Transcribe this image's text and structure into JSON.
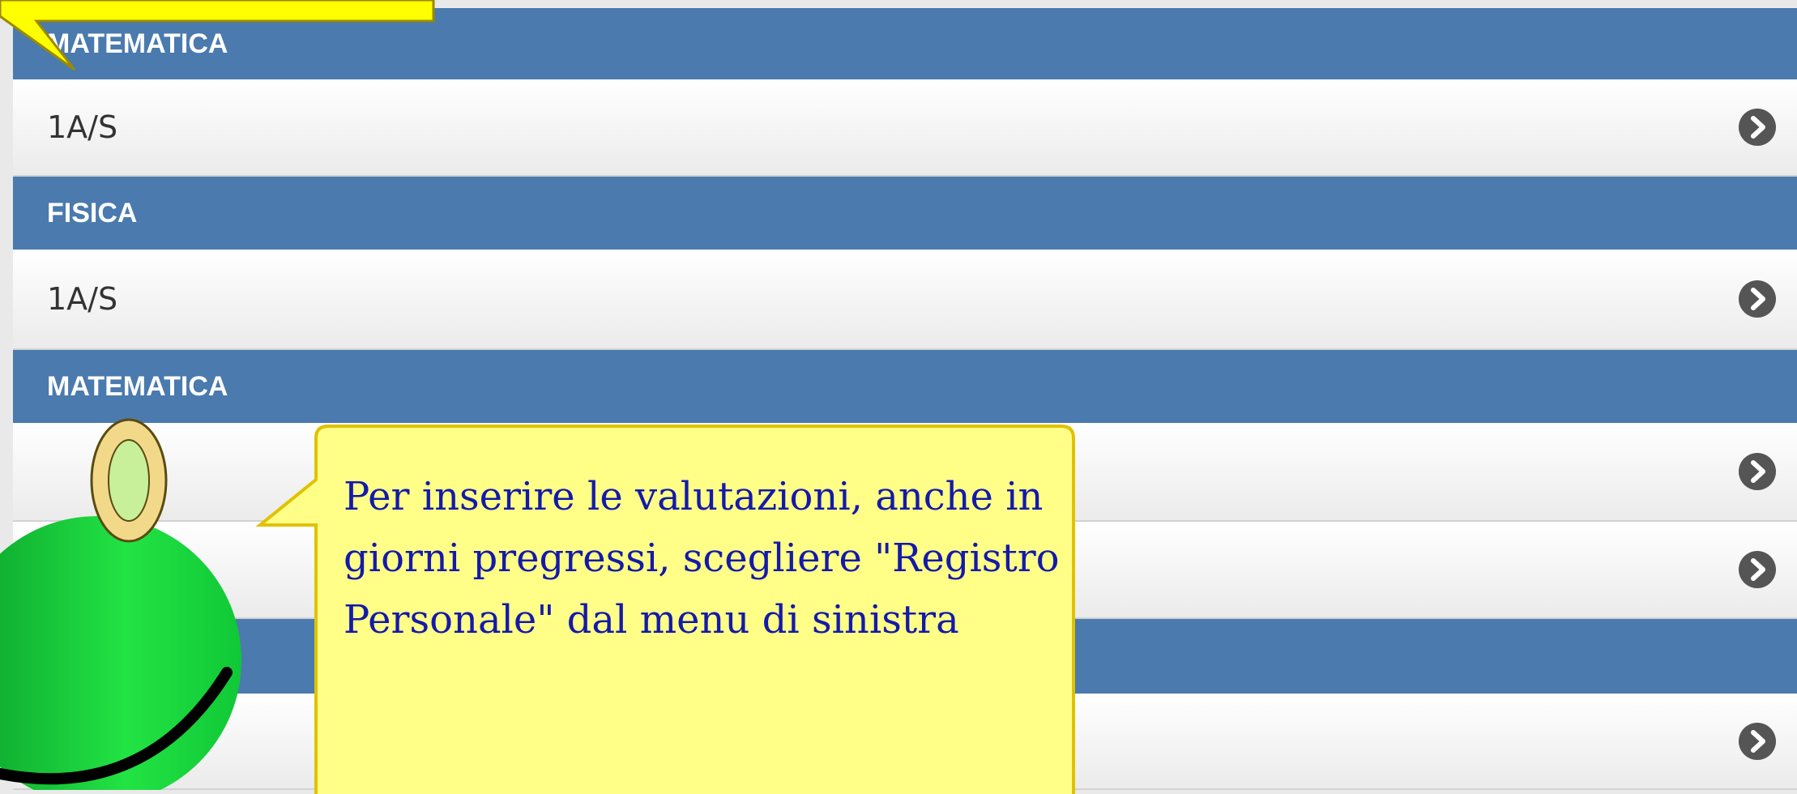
{
  "list": {
    "rows": [
      {
        "type": "header",
        "label": "MATEMATICA"
      },
      {
        "type": "item",
        "label": "1A/S"
      },
      {
        "type": "header",
        "label": "FISICA"
      },
      {
        "type": "item",
        "label": "1A/S"
      },
      {
        "type": "header",
        "label": "MATEMATICA"
      },
      {
        "type": "item",
        "label": ""
      },
      {
        "type": "item",
        "label": ""
      },
      {
        "type": "header",
        "label": ""
      },
      {
        "type": "item",
        "label": ""
      }
    ],
    "chevron_icon": "chevron-right-circle-icon"
  },
  "tutorial": {
    "bubble_text": "Per inserire le valutazioni, anche in giorni pregressi, scegliere \"Registro Personale\" dal menu di sinistra",
    "colors": {
      "bubble_fill": "#ffff88",
      "bubble_border": "#e0c200",
      "bubble_text": "#141aa8",
      "top_callout": "#ffff00",
      "smiley": "#22e344"
    }
  },
  "colors": {
    "header_bg": "#4a7aae",
    "header_text": "#ffffff",
    "item_text": "#333333",
    "page_bg": "#e9e9e9"
  }
}
